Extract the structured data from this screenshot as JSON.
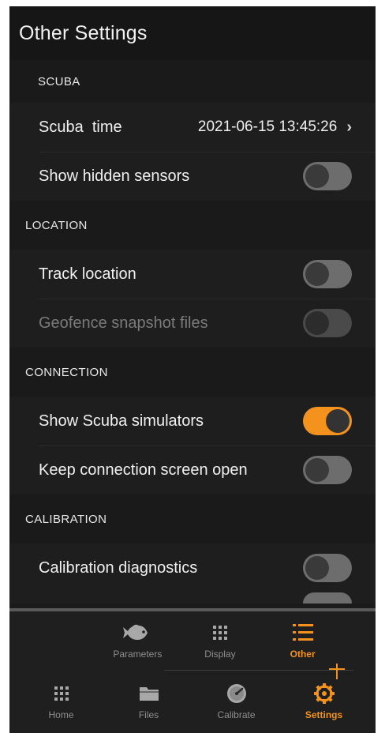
{
  "header": {
    "title": "Other Settings"
  },
  "sections": {
    "scuba": {
      "title": "SCUBA",
      "time_label": "Scuba  time",
      "time_value": "2021-06-15 13:45:26",
      "hidden_sensors_label": "Show hidden sensors"
    },
    "location": {
      "title": "LOCATION",
      "track_label": "Track location",
      "geofence_label": "Geofence snapshot files"
    },
    "connection": {
      "title": "CONNECTION",
      "simulators_label": "Show Scuba simulators",
      "keep_open_label": "Keep connection screen open"
    },
    "calibration": {
      "title": "CALIBRATION",
      "diagnostics_label": "Calibration diagnostics"
    }
  },
  "toggles": {
    "show_hidden_sensors": false,
    "track_location": false,
    "geofence_snapshot_files": false,
    "show_scuba_simulators": true,
    "keep_connection_screen_open": false,
    "calibration_diagnostics": false
  },
  "subtabs": [
    {
      "label": "Parameters",
      "icon": "fish-icon",
      "active": false
    },
    {
      "label": "Display",
      "icon": "grid-icon",
      "active": false
    },
    {
      "label": "Other",
      "icon": "list-icon",
      "active": true
    }
  ],
  "tabs": [
    {
      "label": "Home",
      "icon": "grid-icon",
      "active": false
    },
    {
      "label": "Files",
      "icon": "folder-icon",
      "active": false
    },
    {
      "label": "Calibrate",
      "icon": "gauge-icon",
      "active": false
    },
    {
      "label": "Settings",
      "icon": "gear-icon",
      "active": true
    }
  ],
  "colors": {
    "accent": "#f3931d",
    "background": "#1b1b1b",
    "inactive_tab": "#8e8e8e"
  }
}
